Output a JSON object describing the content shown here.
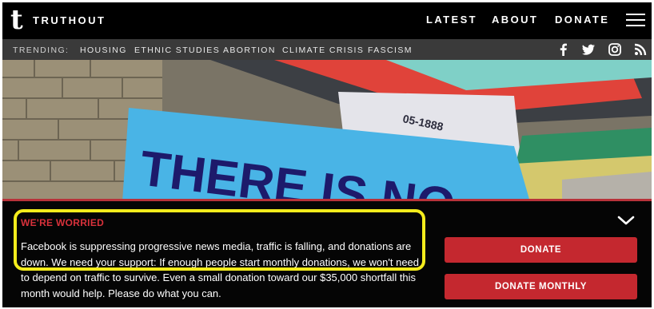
{
  "header": {
    "logo_mark": "t",
    "logo_text": "TRUTHOUT",
    "nav": [
      "LATEST",
      "ABOUT",
      "DONATE"
    ]
  },
  "trending": {
    "label": "TRENDING:",
    "items": [
      "HOUSING",
      "ETHNIC STUDIES",
      "ABORTION",
      "CLIMATE CRISIS",
      "FASCISM"
    ],
    "social": [
      "facebook-icon",
      "twitter-icon",
      "instagram-icon",
      "rss-icon"
    ]
  },
  "hero": {
    "sign_text_1": "THERE IS NO",
    "sign_text_2": "05-1888"
  },
  "banner": {
    "kicker": "WE'RE WORRIED",
    "message": "Facebook is suppressing progressive news media, traffic is falling, and donations are down. We need your support: If enough people start monthly donations, we won't need to depend on traffic to survive. Even a small donation toward our $35,000 shortfall this month would help. Please do what you can.",
    "donate_label": "DONATE",
    "donate_monthly_label": "DONATE MONTHLY"
  },
  "colors": {
    "accent_red": "#c4282f",
    "highlight_yellow": "#f4ec1c"
  }
}
